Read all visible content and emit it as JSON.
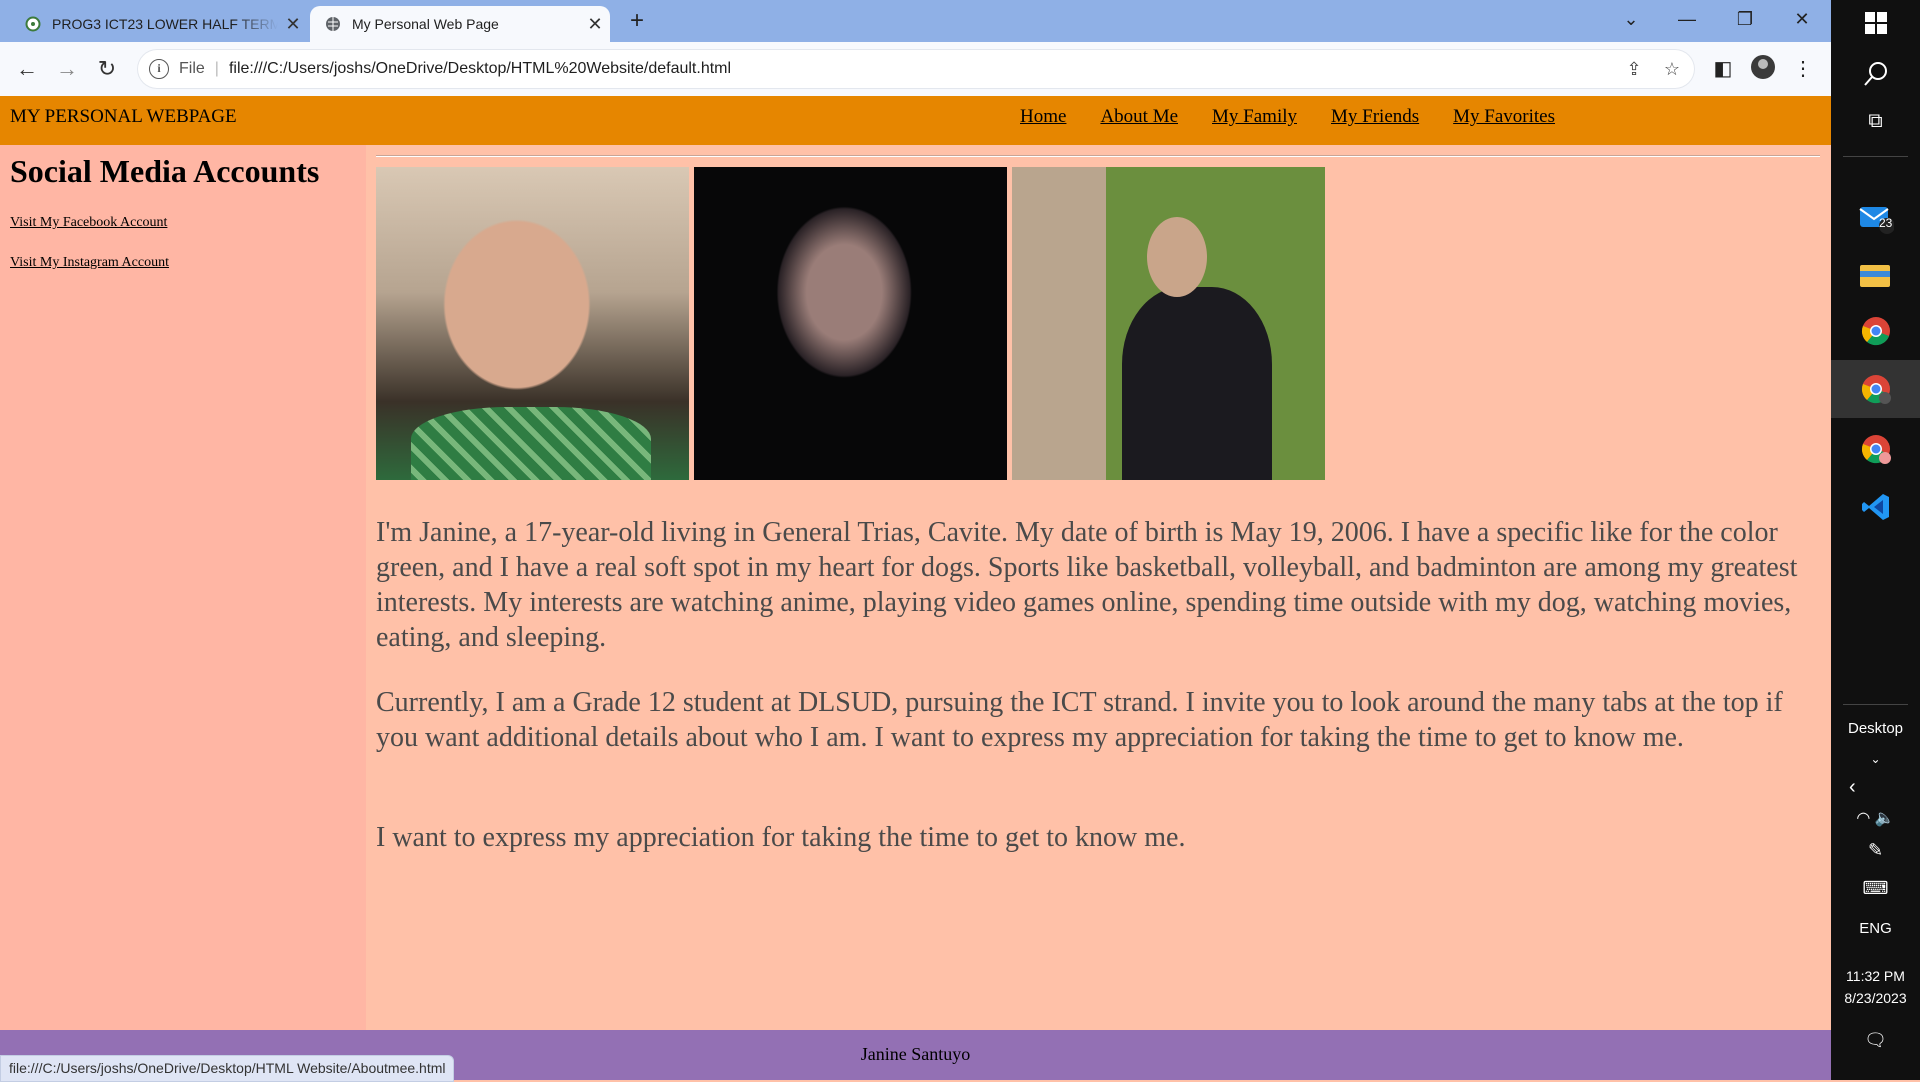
{
  "browser": {
    "tabs": [
      {
        "title": "PROG3 ICT23 LOWER HALF TERM",
        "active": false
      },
      {
        "title": "My Personal Web Page",
        "active": true
      }
    ],
    "new_tab": "+",
    "address": {
      "scheme": "File",
      "url": "file:///C:/Users/joshs/OneDrive/Desktop/HTML%20Website/default.html"
    },
    "status_url": "file:///C:/Users/joshs/OneDrive/Desktop/HTML Website/Aboutmee.html"
  },
  "site": {
    "title": "MY PERSONAL WEBPAGE",
    "nav": [
      "Home",
      "About Me",
      "My Family",
      "My Friends",
      "My Favorites"
    ],
    "sidebar": {
      "heading": "Social Media Accounts",
      "links": [
        "Visit My Facebook Account",
        "Visit My Instagram Account"
      ]
    },
    "paragraphs": [
      "I'm Janine, a 17-year-old living in General Trias, Cavite. My date of birth is May 19, 2006. I have a specific like for the color green, and I have a real soft spot in my heart for dogs. Sports like basketball, volleyball, and badminton are among my greatest interests. My interests are watching anime, playing video games online, spending time outside with my dog, watching movies, eating, and sleeping.",
      "Currently, I am a Grade 12 student at DLSUD, pursuing the ICT strand. I invite you to look around the many tabs at the top if you want additional details about who I am. I want to express my appreciation for taking the time to get to know me.",
      "I want to express my appreciation for taking the time to get to know me."
    ],
    "footer": "Janine Santuyo"
  },
  "taskbar": {
    "mail_badge": "23",
    "desktop_label": "Desktop",
    "language": "ENG",
    "time": "11:32 PM",
    "date": "8/23/2023"
  },
  "colors": {
    "header": "#e68600",
    "sidebar": "#ffb6a4",
    "main": "#ffc1a8",
    "footer": "#9370b4"
  }
}
